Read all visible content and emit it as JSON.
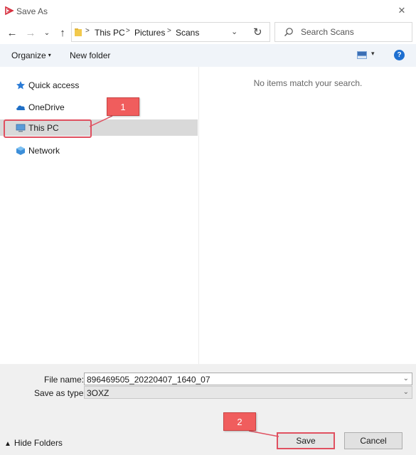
{
  "window": {
    "title": "Save As",
    "close_icon": "close-icon"
  },
  "nav": {
    "back_icon": "arrow-left-icon",
    "forward_icon": "arrow-right-icon",
    "recent_icon": "chevron-down-icon",
    "up_icon": "arrow-up-icon"
  },
  "address": {
    "breadcrumbs": [
      "This PC",
      "Pictures",
      "Scans"
    ],
    "refresh_icon": "refresh-icon"
  },
  "search": {
    "placeholder": "Search Scans"
  },
  "toolbar": {
    "organize_label": "Organize",
    "new_folder_label": "New folder",
    "help_label": "?"
  },
  "sidebar": {
    "items": [
      {
        "label": "Quick access",
        "icon": "star-icon"
      },
      {
        "label": "OneDrive",
        "icon": "cloud-icon"
      },
      {
        "label": "This PC",
        "icon": "computer-icon",
        "selected": true
      },
      {
        "label": "Network",
        "icon": "network-icon"
      }
    ]
  },
  "content": {
    "empty_message": "No items match your search."
  },
  "form": {
    "file_name_label": "File name:",
    "file_name_value": "896469505_20220407_1640_07",
    "save_type_label": "Save as type:",
    "save_type_value": "3OXZ"
  },
  "footer": {
    "hide_folders_label": "Hide Folders",
    "save_label": "Save",
    "cancel_label": "Cancel"
  },
  "annotations": {
    "callout_1": "1",
    "callout_2": "2",
    "color": "#f05d5d"
  },
  "colors": {
    "accent": "#1e6fd0",
    "toolbar_bg": "#f0f4f9",
    "selected_bg": "#d9d9d9",
    "highlight": "#e05060"
  }
}
